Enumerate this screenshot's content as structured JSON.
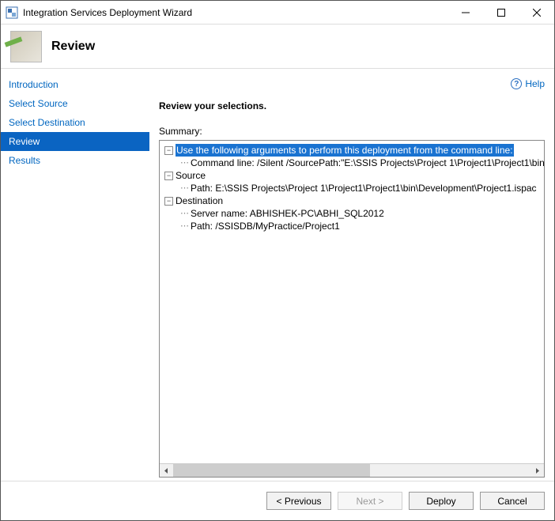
{
  "window": {
    "title": "Integration Services Deployment Wizard"
  },
  "header": {
    "title": "Review"
  },
  "help": {
    "label": "Help"
  },
  "sidebar": {
    "items": [
      {
        "label": "Introduction"
      },
      {
        "label": "Select Source"
      },
      {
        "label": "Select Destination"
      },
      {
        "label": "Review"
      },
      {
        "label": "Results"
      }
    ],
    "active_index": 3
  },
  "main": {
    "section_title": "Review your selections.",
    "summary_label": "Summary:"
  },
  "tree": {
    "root": {
      "label": "Use the following arguments to perform this deployment from the command line:",
      "children": [
        {
          "label": "Command line: /Silent /SourcePath:\"E:\\SSIS Projects\\Project 1\\Project1\\Project1\\bin\\Dev"
        }
      ]
    },
    "source": {
      "label": "Source",
      "path": "Path: E:\\SSIS Projects\\Project 1\\Project1\\Project1\\bin\\Development\\Project1.ispac"
    },
    "destination": {
      "label": "Destination",
      "server": "Server name: ABHISHEK-PC\\ABHI_SQL2012",
      "path": "Path: /SSISDB/MyPractice/Project1"
    }
  },
  "buttons": {
    "previous": "< Previous",
    "next": "Next >",
    "deploy": "Deploy",
    "cancel": "Cancel"
  }
}
